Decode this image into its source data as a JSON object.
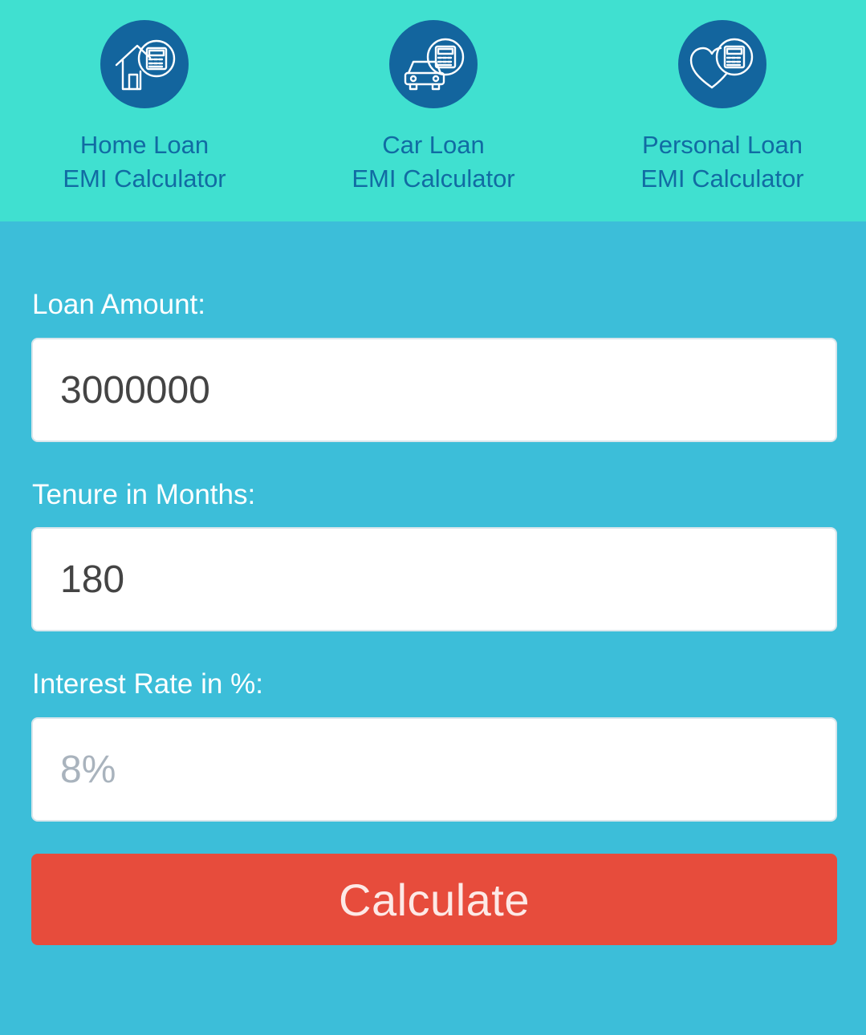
{
  "colors": {
    "header_bg": "#40e0d0",
    "body_bg": "#3cbed9",
    "icon_circle": "#13659e",
    "nav_text": "#116ba3",
    "button_bg": "#e74c3c"
  },
  "nav": {
    "items": [
      {
        "icon": "house-calculator-icon",
        "line1": "Home Loan",
        "line2": "EMI Calculator"
      },
      {
        "icon": "car-calculator-icon",
        "line1": "Car Loan",
        "line2": "EMI Calculator"
      },
      {
        "icon": "heart-calculator-icon",
        "line1": "Personal Loan",
        "line2": "EMI Calculator"
      }
    ]
  },
  "form": {
    "loan_amount": {
      "label": "Loan Amount:",
      "value": "3000000",
      "placeholder": ""
    },
    "tenure": {
      "label": "Tenure in Months:",
      "value": "180",
      "placeholder": ""
    },
    "interest": {
      "label": "Interest Rate in %:",
      "value": "",
      "placeholder": "8%"
    },
    "calculate_label": "Calculate"
  }
}
